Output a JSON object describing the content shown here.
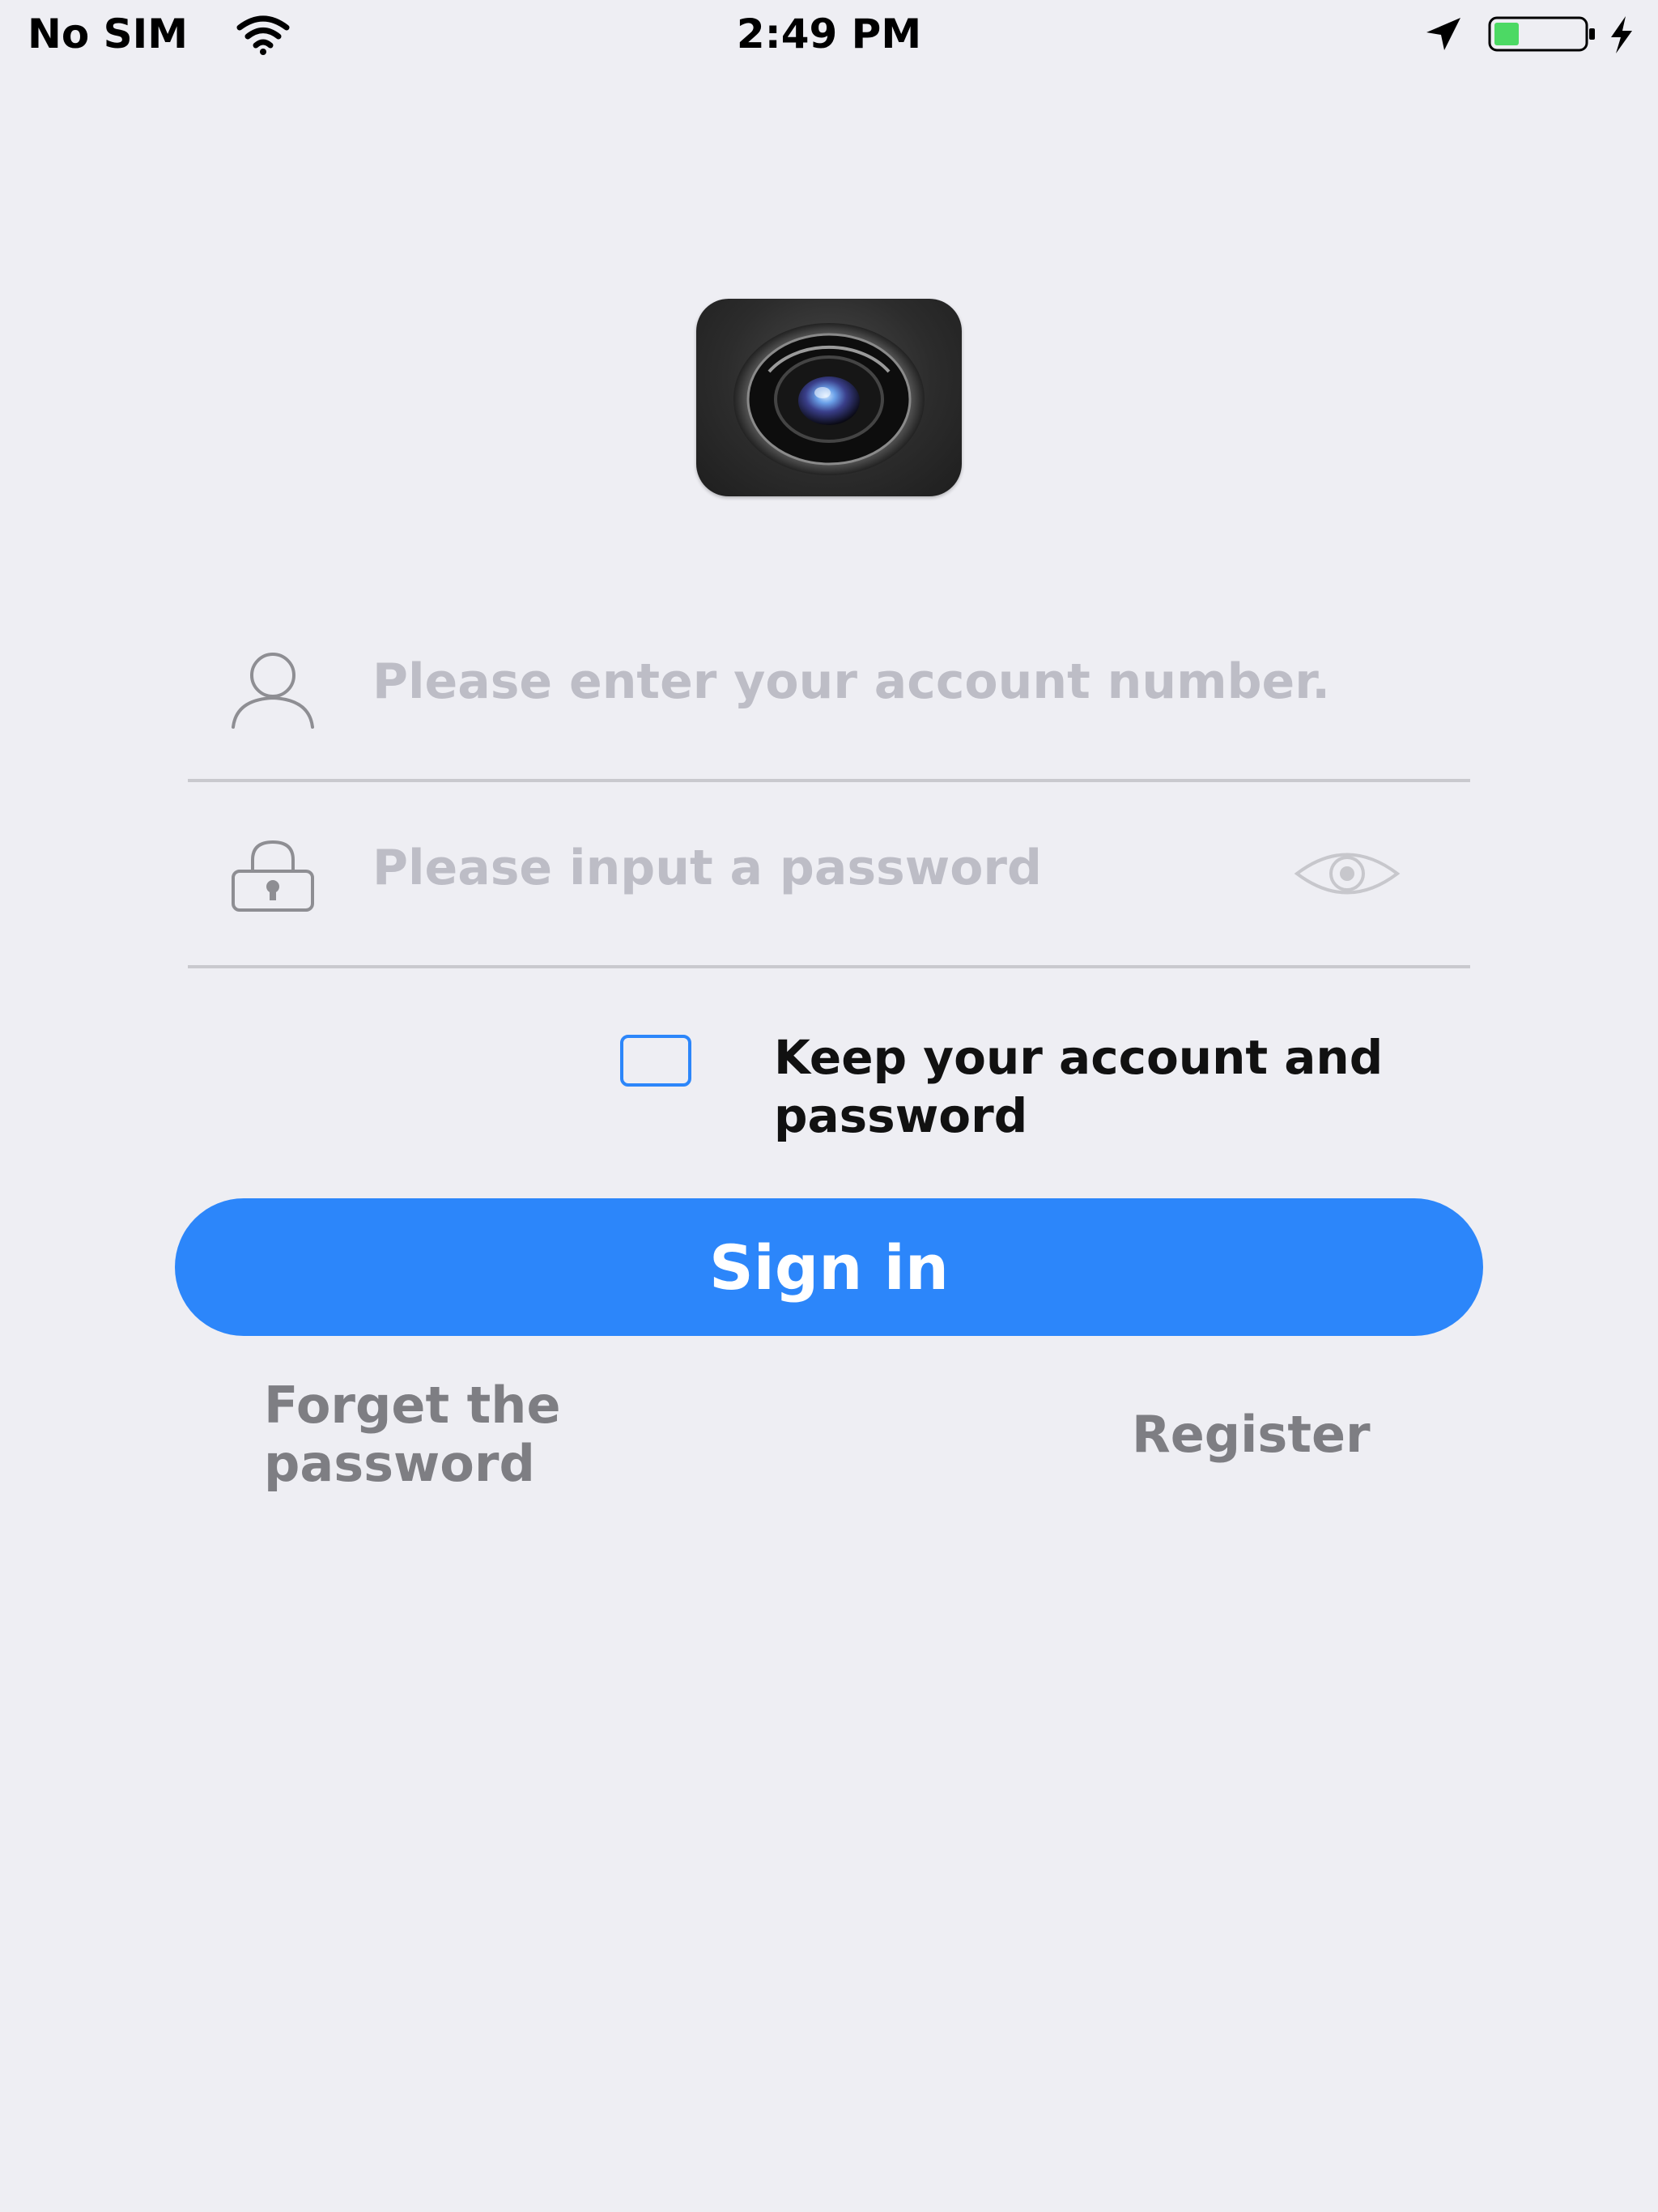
{
  "status_bar": {
    "carrier": "No SIM",
    "time": "2:49 PM",
    "battery_color": "#4CD964"
  },
  "logo": {
    "icon": "camera-lens-icon"
  },
  "account_field": {
    "icon": "user-icon",
    "placeholder": "Please enter your account number.",
    "value": ""
  },
  "password_field": {
    "icon": "lock-icon",
    "placeholder": "Please input a password",
    "value": "",
    "toggle_icon": "eye-icon"
  },
  "remember": {
    "checked": false,
    "label": "Keep your account and password"
  },
  "sign_in": {
    "label": "Sign in",
    "color": "#2C86FA"
  },
  "links": {
    "forget": "Forget the password",
    "register": "Register"
  },
  "colors": {
    "background": "#EEEEF3",
    "accent": "#2C86FA",
    "link_gray": "#7E7E83"
  }
}
